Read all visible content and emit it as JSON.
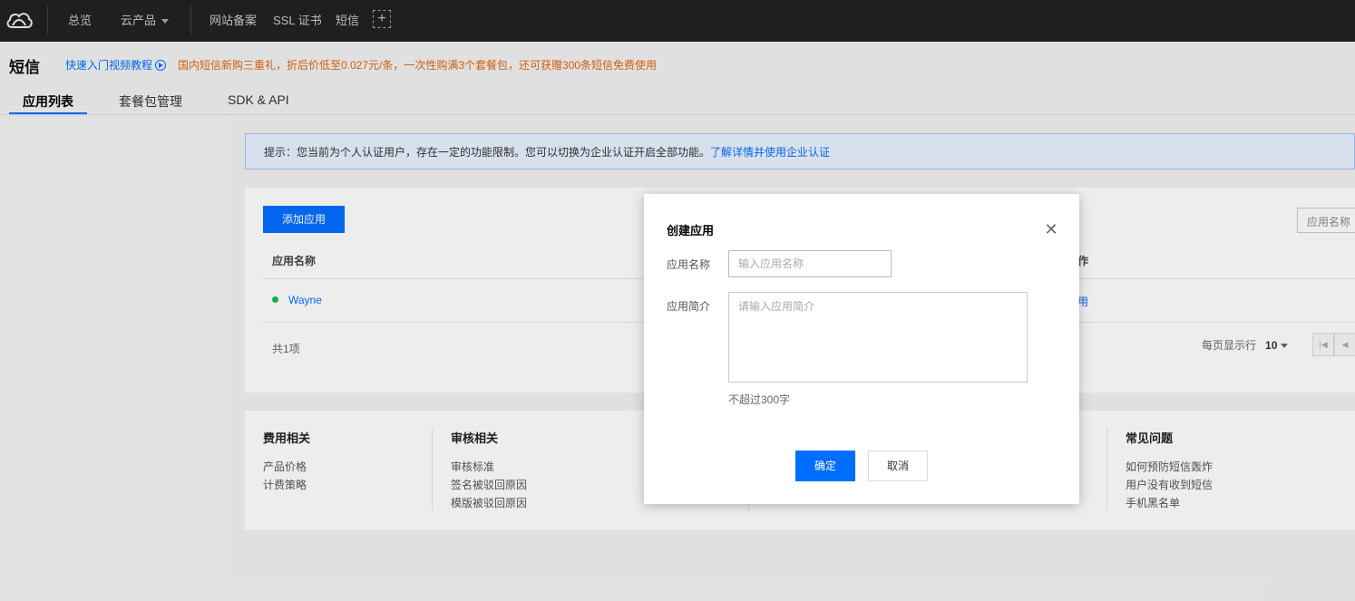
{
  "nav": {
    "items": [
      "总览",
      "云产品",
      "网站备案",
      "SSL 证书",
      "短信"
    ],
    "plus": "+"
  },
  "header": {
    "title": "短信",
    "video_link": "快速入门视频教程",
    "promo": "国内短信新购三重礼，折后价低至0.027元/条，一次性购满3个套餐包，还可获赠300条短信免费使用"
  },
  "tabs": [
    "应用列表",
    "套餐包管理",
    "SDK & API"
  ],
  "notice": {
    "text": "提示：您当前为个人认证用户，存在一定的功能限制。您可以切换为企业认证开启全部功能。",
    "link": "了解详情并使用企业认证"
  },
  "app_list": {
    "add_button": "添加应用",
    "search_placeholder": "应用名称",
    "columns": [
      "应用名称",
      "作"
    ],
    "rows": [
      {
        "name": "Wayne",
        "op": "用",
        "status_color": "#0abf5b"
      }
    ],
    "total": "共1项",
    "per_page_label": "每页显示行",
    "per_page_value": "10"
  },
  "help": {
    "sections": [
      {
        "title": "费用相关",
        "links": [
          "产品价格",
          "计费策略"
        ]
      },
      {
        "title": "审核相关",
        "links": [
          "审核标准",
          "签名被驳回原因",
          "模版被驳回原因"
        ]
      },
      {
        "title": "常见问题",
        "links": [
          "如何预防短信轰炸",
          "用户没有收到短信",
          "手机黑名单"
        ]
      }
    ]
  },
  "modal": {
    "title": "创建应用",
    "name_label": "应用名称",
    "name_placeholder": "输入应用名称",
    "desc_label": "应用简介",
    "desc_placeholder": "请输入应用简介",
    "desc_hint": "不超过300字",
    "confirm": "确定",
    "cancel": "取消"
  },
  "colors": {
    "accent": "#006eff",
    "promo": "#e0670f",
    "topbar": "#1f1f1f"
  }
}
